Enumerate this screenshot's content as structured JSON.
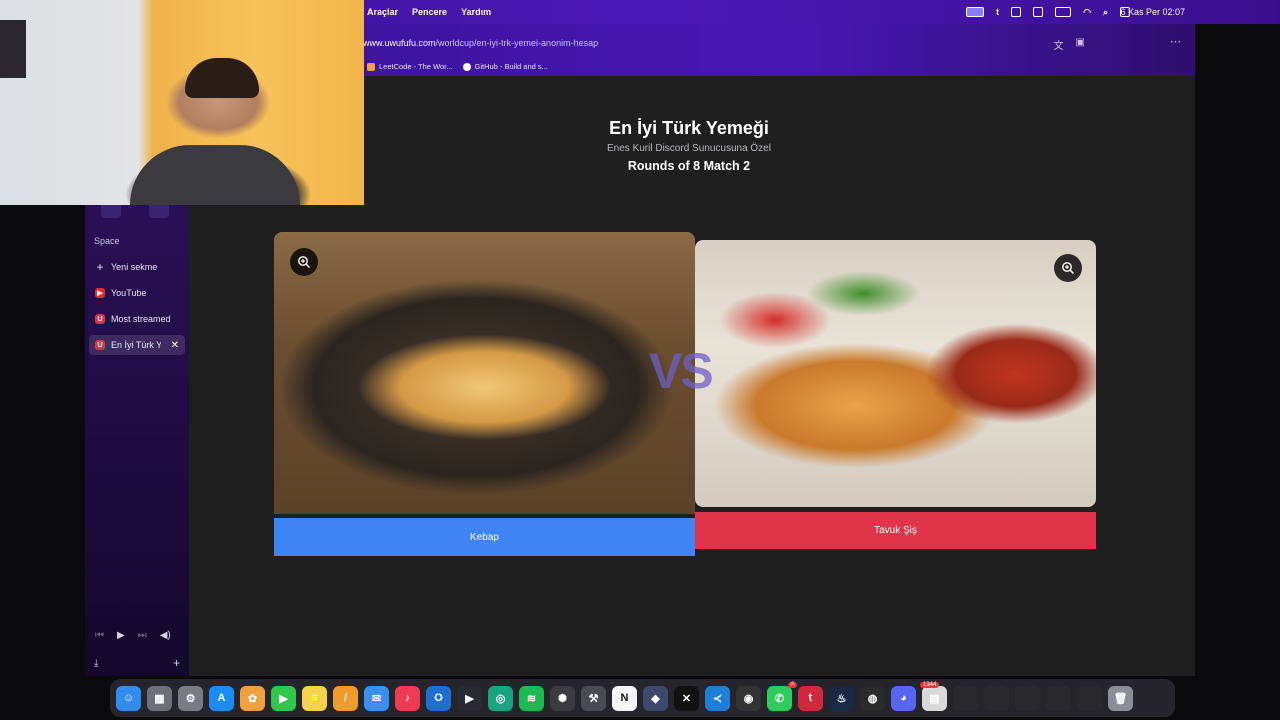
{
  "menubar": {
    "menus": [
      "Araçlar",
      "Pencere",
      "Yardım"
    ],
    "clock": "6 Kas Per  02:07"
  },
  "browser": {
    "url_domain": "www.uwufufu.com",
    "url_path": "/worldcup/en-iyi-trk-yemei-anonim-hesap",
    "bookmarks": [
      {
        "label": "LeetCode - The Wor...",
        "icon": "leetcode-icon"
      },
      {
        "label": "GitHub - Build and s...",
        "icon": "github-icon"
      }
    ]
  },
  "sidebar": {
    "space_label": "Space",
    "tabs": [
      {
        "label": "Yeni sekme",
        "icon": "plus-icon"
      },
      {
        "label": "YouTube",
        "icon": "youtube-icon"
      },
      {
        "label": "Most streamed",
        "icon": "uwufufu-icon"
      },
      {
        "label": "En İyi Türk Y",
        "icon": "uwufufu-icon",
        "active": true
      }
    ]
  },
  "page": {
    "title": "En İyi Türk Yemeği",
    "subtitle": "Enes Kuril Discord Sunucusuna Özel",
    "round": "Rounds of 8 Match 2",
    "vs": "VS",
    "left_choice": "Kebap",
    "right_choice": "Tavuk Şiş"
  },
  "dock": {
    "apps": [
      {
        "name": "finder-icon",
        "color": "#2f8cf0",
        "glyph": "☺"
      },
      {
        "name": "launchpad-icon",
        "color": "#6f6f7a",
        "glyph": "▦"
      },
      {
        "name": "settings-icon",
        "color": "#7b7b85",
        "glyph": "⚙"
      },
      {
        "name": "app-store-icon",
        "color": "#1a8cf5",
        "glyph": "A"
      },
      {
        "name": "photos-icon",
        "color": "#f0a040",
        "glyph": "✿"
      },
      {
        "name": "facetime-icon",
        "color": "#2fc84a",
        "glyph": "▶"
      },
      {
        "name": "notes-icon",
        "color": "#f6d34a",
        "glyph": "≡"
      },
      {
        "name": "pages-icon",
        "color": "#f29a2b",
        "glyph": "/"
      },
      {
        "name": "mail-icon",
        "color": "#3a8ff0",
        "glyph": "✉"
      },
      {
        "name": "music-icon",
        "color": "#f03a53",
        "glyph": "♪"
      },
      {
        "name": "outlook-icon",
        "color": "#1f6fd1",
        "glyph": "O"
      },
      {
        "name": "terminal-icon",
        "color": "#2a2a35",
        "glyph": "▶"
      },
      {
        "name": "chatgpt-icon",
        "color": "#1aa37f",
        "glyph": "◎"
      },
      {
        "name": "spotify-icon",
        "color": "#1db954",
        "glyph": "≋"
      },
      {
        "name": "openai-icon",
        "color": "#3a3a40",
        "glyph": "✺"
      },
      {
        "name": "instruments-icon",
        "color": "#4a4a55",
        "glyph": "⚒"
      },
      {
        "name": "notion-icon",
        "color": "#f5f5f5",
        "glyph": "N"
      },
      {
        "name": "davinci-icon",
        "color": "#3b4a6b",
        "glyph": "◆"
      },
      {
        "name": "capcut-icon",
        "color": "#111",
        "glyph": "✕"
      },
      {
        "name": "vscode-icon",
        "color": "#1f7fd6",
        "glyph": "≺"
      },
      {
        "name": "obs-icon",
        "color": "#333",
        "glyph": "◉"
      },
      {
        "name": "whatsapp-icon",
        "color": "#2ecc5a",
        "glyph": "✆"
      },
      {
        "name": "tumblr-icon",
        "color": "#d0283c",
        "glyph": "t"
      },
      {
        "name": "steam-icon",
        "color": "#1b2a44",
        "glyph": "♨"
      },
      {
        "name": "obs-studio-icon",
        "color": "#2b2b2b",
        "glyph": "◍"
      },
      {
        "name": "discord-icon",
        "color": "#5865f2",
        "glyph": "◕"
      },
      {
        "name": "document-icon",
        "color": "#d9d9d9",
        "glyph": "▤"
      },
      {
        "name": "window-thumb-1-icon",
        "color": "#2a2a2e",
        "glyph": ""
      },
      {
        "name": "window-thumb-2-icon",
        "color": "#2a2a2e",
        "glyph": ""
      },
      {
        "name": "window-thumb-3-icon",
        "color": "#2a2a2e",
        "glyph": ""
      },
      {
        "name": "window-thumb-4-icon",
        "color": "#2a2a2e",
        "glyph": ""
      },
      {
        "name": "window-thumb-5-icon",
        "color": "#2a2a2e",
        "glyph": ""
      },
      {
        "name": "trash-icon",
        "color": "#8d8d95",
        "glyph": "🗑"
      }
    ],
    "badges": {
      "whatsapp": "8",
      "discord": "1344"
    }
  }
}
